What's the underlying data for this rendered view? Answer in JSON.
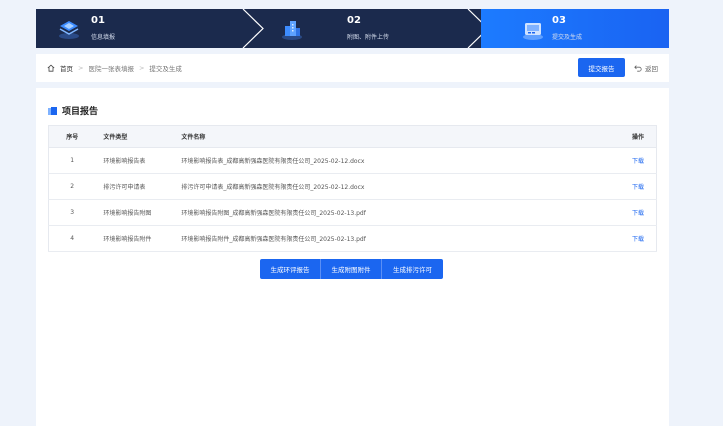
{
  "steps": [
    {
      "number": "01",
      "label": "信息填报"
    },
    {
      "number": "02",
      "label": "附图、附件上传"
    },
    {
      "number": "03",
      "label": "提交及生成"
    }
  ],
  "breadcrumb": {
    "home": "首页",
    "items": [
      "医院一张表填报",
      "提交及生成"
    ],
    "separator": ">"
  },
  "toolbar": {
    "submit_label": "提交报告",
    "back_label": "返回"
  },
  "section": {
    "title": "项目报告"
  },
  "table": {
    "headers": {
      "index": "序号",
      "type": "文件类型",
      "name": "文件名称",
      "op": "操作"
    },
    "rows": [
      {
        "index": "1",
        "type": "环境影响报告表",
        "name": "环境影响报告表_成都高新强森医院有限责任公司_2025-02-12.docx",
        "op": "下载"
      },
      {
        "index": "2",
        "type": "排污许可申请表",
        "name": "排污许可申请表_成都高新强森医院有限责任公司_2025-02-12.docx",
        "op": "下载"
      },
      {
        "index": "3",
        "type": "环境影响报告附图",
        "name": "环境影响报告附图_成都高新强森医院有限责任公司_2025-02-13.pdf",
        "op": "下载"
      },
      {
        "index": "4",
        "type": "环境影响报告附件",
        "name": "环境影响报告附件_成都高新强森医院有限责任公司_2025-02-13.pdf",
        "op": "下载"
      }
    ]
  },
  "actions": {
    "generate_eia": "生成环评报告",
    "generate_attachments": "生成附图附件",
    "generate_permit": "生成排污许可"
  },
  "colors": {
    "primary": "#1b66f0",
    "steps_bg": "#1b2a4d",
    "page_bg": "#eef3fb"
  },
  "icons": {
    "step1": "layers-icon",
    "step2": "buildings-icon",
    "step3": "cloud-panel-icon",
    "home": "home-icon",
    "back": "undo-icon"
  }
}
